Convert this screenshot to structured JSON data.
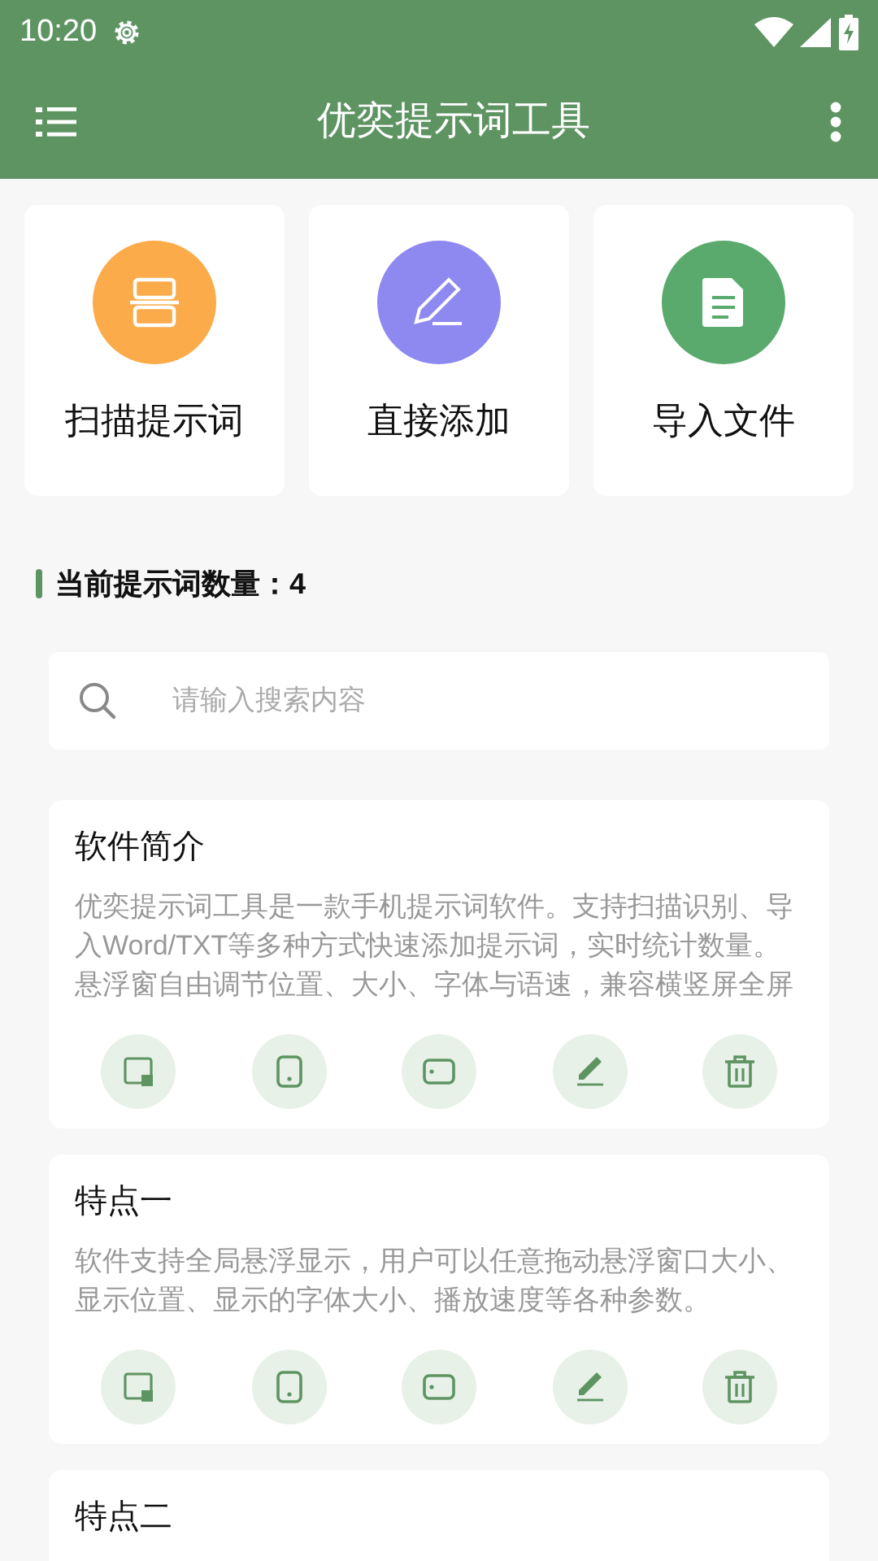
{
  "status_bar": {
    "time": "10:20"
  },
  "app_bar": {
    "title": "优奕提示词工具"
  },
  "actions": [
    {
      "label": "扫描提示词",
      "color": "#fbab4a"
    },
    {
      "label": "直接添加",
      "color": "#8e89f0"
    },
    {
      "label": "导入文件",
      "color": "#5aaa6e"
    }
  ],
  "count_heading": "当前提示词数量：4",
  "search": {
    "placeholder": "请输入搜索内容"
  },
  "prompts": [
    {
      "title": "软件简介",
      "description": "优奕提示词工具是一款手机提示词软件。支持扫描识别、导入Word/TXT等多种方式快速添加提示词，实时统计数量。悬浮窗自由调节位置、大小、字体与语速，兼容横竖屏全屏"
    },
    {
      "title": "特点一",
      "description": "软件支持全局悬浮显示，用户可以任意拖动悬浮窗口大小、显示位置、显示的字体大小、播放速度等各种参数。"
    },
    {
      "title": "特点二"
    }
  ]
}
